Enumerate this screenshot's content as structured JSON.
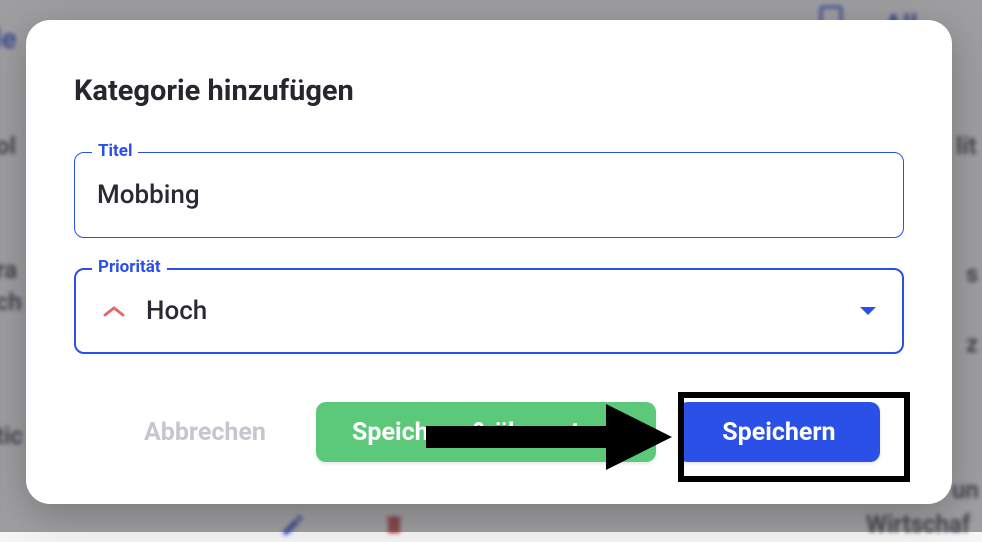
{
  "modal": {
    "title": "Kategorie hinzufügen",
    "fields": {
      "title": {
        "label": "Titel",
        "value": "Mobbing"
      },
      "priority": {
        "label": "Priorität",
        "selected": "Hoch"
      }
    },
    "actions": {
      "cancel": "Abbrechen",
      "save_translate": "Speichern & übersetzen",
      "save": "Speichern"
    }
  },
  "background": {
    "link_top_right": "All",
    "fragment_right_1": "lit",
    "fragment_right_2": "s",
    "fragment_right_3": "z",
    "fragment_right_4": "un",
    "fragment_right_5": "Wirtschaf",
    "fragment_left_1": "le",
    "fragment_left_2": "ol",
    "fragment_left_3": "ra",
    "fragment_left_4": "ch",
    "fragment_left_5": "tic"
  }
}
